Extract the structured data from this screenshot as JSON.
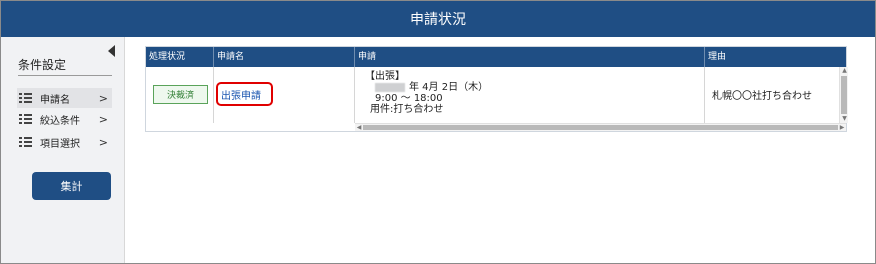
{
  "header": {
    "title": "申請状況"
  },
  "sidebar": {
    "title": "条件設定",
    "collapse_icon": "triangle-left-icon",
    "items": [
      {
        "label": "申請名",
        "icon": "list-icon",
        "chevron": ">"
      },
      {
        "label": "絞込条件",
        "icon": "list-icon",
        "chevron": ">"
      },
      {
        "label": "項目選択",
        "icon": "list-icon",
        "chevron": ">"
      }
    ],
    "total_button": "集計"
  },
  "table": {
    "columns": [
      "処理状況",
      "申請名",
      "申請",
      "理由"
    ],
    "rows": [
      {
        "status": "決裁済",
        "application_name": "出張申請",
        "detail": {
          "line1": "【出張】",
          "line2": "年 4月 2日（木）",
          "line3": "9:00 〜 18:00",
          "line4": "用件:打ち合わせ"
        },
        "reason": "札幌〇〇社打ち合わせ"
      }
    ]
  },
  "colors": {
    "header": "#1f4e84",
    "button": "#1f4e84",
    "status_border": "#5aa35a",
    "highlight": "#e00000"
  }
}
